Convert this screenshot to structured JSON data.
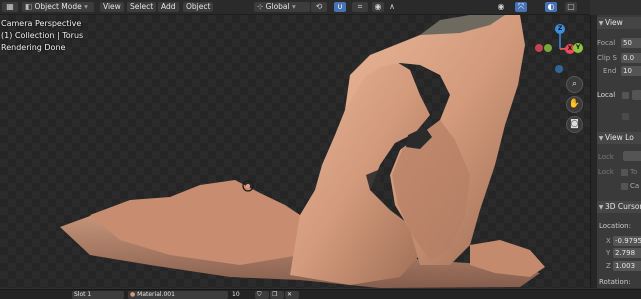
{
  "header": {
    "editor_type_icon": "viewport-editor-icon",
    "mode": "Object Mode",
    "menus": [
      "View",
      "Select",
      "Add",
      "Object"
    ],
    "transform_orientation": "Global",
    "icons": {
      "orientation": "axes-icon",
      "pivot": "pivot-icon",
      "snap": "magnet-icon",
      "proportional": "proportional-edit-icon",
      "visibility": "eye-icon",
      "gizmo": "gizmo-icon",
      "overlay": "overlay-icon",
      "xray": "xray-icon",
      "shading": "shading-icon"
    }
  },
  "viewport": {
    "overlay_lines": [
      "Camera Perspective",
      "(1) Collection | Torus",
      "Rendering Done"
    ],
    "gizmo": {
      "z": "Z",
      "y": "Y",
      "x": "X"
    },
    "nav_icons": [
      "zoom-icon",
      "hand-pan-icon",
      "camera-icon"
    ]
  },
  "npanel": {
    "view_section": "View",
    "focal_label": "Focal",
    "focal_value": "50",
    "clip_start_label": "Clip S",
    "clip_start_value": "0.0",
    "clip_end_label": "End",
    "clip_end_value": "10",
    "local_label": "Local",
    "view_lock_section": "View Lo",
    "lock_label": "Lock",
    "lock_label_2": "Lock",
    "lock_options": [
      "To",
      "Ca"
    ],
    "cursor_section": "3D Cursor",
    "location_label": "Location:",
    "x_label": "X",
    "x_value": "-0.9795",
    "y_label": "Y",
    "y_value": "2.798",
    "z_label": "Z",
    "z_value": "1.003",
    "rotation_label": "Rotation:"
  },
  "statusbar": {
    "slot": "Slot 1",
    "material": "Material.001",
    "count": "10"
  },
  "colors": {
    "accent": "#4772b3",
    "rock": "#d39a7c",
    "axis_x": "#e94b5b",
    "axis_y": "#8cc63f",
    "axis_z": "#3b8fdb"
  }
}
